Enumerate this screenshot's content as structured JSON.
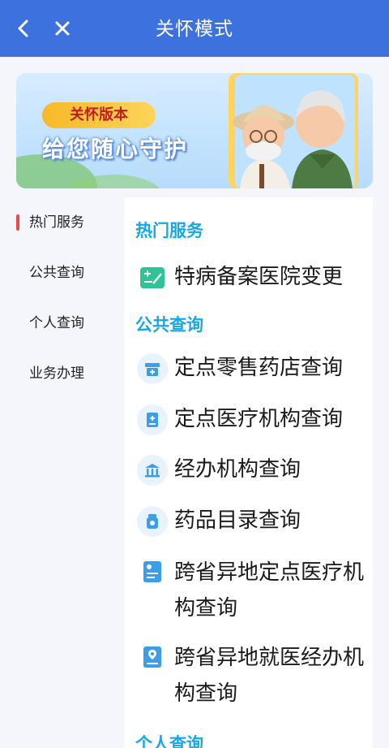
{
  "header": {
    "title": "关怀模式"
  },
  "banner": {
    "tag": "关怀版本",
    "slogan": "给您随心守护"
  },
  "sidebar": {
    "items": [
      {
        "label": "热门服务"
      },
      {
        "label": "公共查询"
      },
      {
        "label": "个人查询"
      },
      {
        "label": "业务办理"
      }
    ]
  },
  "content": {
    "sections": [
      {
        "title": "热门服务",
        "items": [
          {
            "label": "特病备案医院变更",
            "icon": "edit-card-icon"
          }
        ]
      },
      {
        "title": "公共查询",
        "items": [
          {
            "label": "定点零售药店查询",
            "icon": "pharmacy-store-icon"
          },
          {
            "label": "定点医疗机构查询",
            "icon": "medical-document-icon"
          },
          {
            "label": "经办机构查询",
            "icon": "institution-building-icon"
          },
          {
            "label": "药品目录查询",
            "icon": "medicine-bottle-icon"
          },
          {
            "label": "跨省异地定点医疗机构查询",
            "icon": "medical-report-icon"
          },
          {
            "label": "跨省异地就医经办机构查询",
            "icon": "location-document-icon"
          }
        ]
      },
      {
        "title": "个人查询",
        "items": []
      }
    ]
  },
  "colors": {
    "header_bg": "#3d72de",
    "accent": "#14a8e8",
    "active_marker": "#e94b4b"
  }
}
